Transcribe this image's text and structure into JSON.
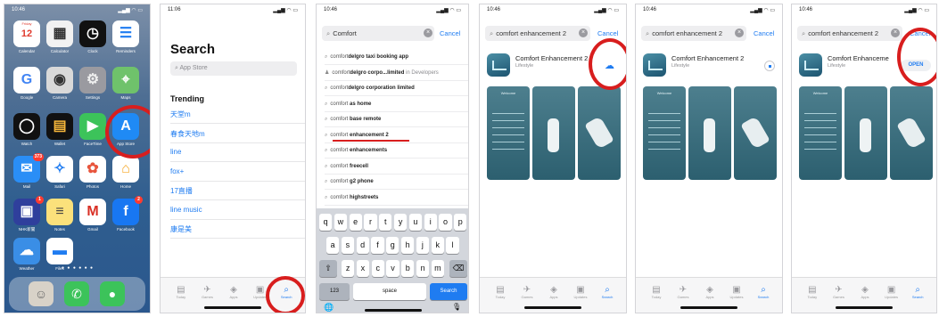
{
  "panel1": {
    "time": "10:46",
    "apps": [
      {
        "label": "Calendar",
        "glyph": "12",
        "sub": "Friday",
        "bg": "#ffffff",
        "fg": "#e03c2f"
      },
      {
        "label": "Calculator",
        "glyph": "▦",
        "bg": "#f2f2f2",
        "fg": "#333"
      },
      {
        "label": "Clock",
        "glyph": "◷",
        "bg": "#111111",
        "fg": "#fff"
      },
      {
        "label": "Reminders",
        "glyph": "☰",
        "bg": "#ffffff",
        "fg": "#1f7cf1"
      },
      {
        "label": "Google",
        "glyph": "G",
        "bg": "#ffffff",
        "fg": "#4285f4"
      },
      {
        "label": "Camera",
        "glyph": "◉",
        "bg": "#d9d9d9",
        "fg": "#333"
      },
      {
        "label": "Settings",
        "glyph": "⚙",
        "bg": "#9a9aa0",
        "fg": "#eee"
      },
      {
        "label": "Maps",
        "glyph": "⌖",
        "bg": "#6fc26b",
        "fg": "#fff"
      },
      {
        "label": "Watch",
        "glyph": "◯",
        "bg": "#111111",
        "fg": "#fff"
      },
      {
        "label": "Wallet",
        "glyph": "▤",
        "bg": "#111111",
        "fg": "#f5b63a"
      },
      {
        "label": "FaceTime",
        "glyph": "▶",
        "bg": "#3cc35a",
        "fg": "#fff"
      },
      {
        "label": "App Store",
        "glyph": "A",
        "bg": "#1f8af5",
        "fg": "#fff"
      },
      {
        "label": "Mail",
        "glyph": "✉",
        "bg": "#2a8ef6",
        "fg": "#fff",
        "badge": "373"
      },
      {
        "label": "Safari",
        "glyph": "✧",
        "bg": "#ffffff",
        "fg": "#1f7cf1"
      },
      {
        "label": "Photos",
        "glyph": "✿",
        "bg": "#ffffff",
        "fg": "#e8553d"
      },
      {
        "label": "Home",
        "glyph": "⌂",
        "bg": "#ffffff",
        "fg": "#f6a623"
      },
      {
        "label": "NHK新聞",
        "glyph": "▣",
        "bg": "#2f3f9c",
        "fg": "#fff",
        "badge": "1"
      },
      {
        "label": "Notes",
        "glyph": "≡",
        "bg": "#fbe17b",
        "fg": "#444"
      },
      {
        "label": "Gmail",
        "glyph": "M",
        "bg": "#ffffff",
        "fg": "#d93025"
      },
      {
        "label": "Facebook",
        "glyph": "f",
        "bg": "#1877f2",
        "fg": "#fff",
        "badge": "2"
      },
      {
        "label": "Weather",
        "glyph": "☁",
        "bg": "#3a8ee6",
        "fg": "#fff"
      },
      {
        "label": "Files",
        "glyph": "▬",
        "bg": "#ffffff",
        "fg": "#1f7cf1"
      }
    ],
    "dock": [
      {
        "glyph": "☺",
        "bg": "#d8d2c8",
        "fg": "#666"
      },
      {
        "glyph": "✆",
        "bg": "#3cc35a",
        "fg": "#fff"
      },
      {
        "glyph": "●",
        "bg": "#3cc35a",
        "fg": "#fff"
      }
    ]
  },
  "panel2": {
    "time": "11:06",
    "title": "Search",
    "placeholder": "App Store",
    "trending_title": "Trending",
    "trending": [
      "天堂m",
      "春食天地m",
      "line",
      "fox+",
      "17直播",
      "line music",
      "康是美"
    ]
  },
  "panel3": {
    "time": "10:46",
    "query": "Comfort",
    "cancel": "Cancel",
    "suggestions": [
      {
        "pre": "comfort",
        "bold": "delgro taxi booking app",
        "post": "",
        "type": "search"
      },
      {
        "pre": "comfort",
        "bold": "delgro corpo...limited",
        "post": " in Developers",
        "type": "person"
      },
      {
        "pre": "comfort",
        "bold": "delgro corporation limited",
        "post": "",
        "type": "search"
      },
      {
        "pre": "comfort ",
        "bold": "as home",
        "post": "",
        "type": "search"
      },
      {
        "pre": "comfort ",
        "bold": "base remote",
        "post": "",
        "type": "search"
      },
      {
        "pre": "comfort ",
        "bold": "enhancement 2",
        "post": "",
        "type": "search"
      },
      {
        "pre": "comfort ",
        "bold": "enhancements",
        "post": "",
        "type": "search"
      },
      {
        "pre": "comfort ",
        "bold": "freecell",
        "post": "",
        "type": "search"
      },
      {
        "pre": "comfort ",
        "bold": "g2 phone",
        "post": "",
        "type": "search"
      },
      {
        "pre": "comfort ",
        "bold": "highstreets",
        "post": "",
        "type": "search"
      }
    ],
    "keyboard": {
      "row1": [
        "q",
        "w",
        "e",
        "r",
        "t",
        "y",
        "u",
        "i",
        "o",
        "p"
      ],
      "row2": [
        "a",
        "s",
        "d",
        "f",
        "g",
        "h",
        "j",
        "k",
        "l"
      ],
      "row3": [
        "z",
        "x",
        "c",
        "v",
        "b",
        "n",
        "m"
      ],
      "shift": "⇧",
      "backspace": "⌫",
      "numbers": "123",
      "space": "space",
      "search": "Search",
      "globe": "🌐",
      "mic": "🎙"
    }
  },
  "results": {
    "query": "comfort enhancement 2",
    "cancel": "Cancel",
    "app_name": "Comfort Enhancement 2",
    "app_name_short": "Comfort Enhanceme",
    "category": "Lifestyle",
    "open_label": "OPEN",
    "shot_title": "Welcome",
    "time": "10:46"
  },
  "tabs": {
    "panel2": [
      "Today",
      "Games",
      "Apps",
      "Updates",
      "Search"
    ],
    "results": [
      "Today",
      "Games",
      "Apps",
      "Updates",
      "Search"
    ]
  },
  "colors": {
    "accent": "#1f7cf1",
    "highlight": "#d81e1e"
  }
}
